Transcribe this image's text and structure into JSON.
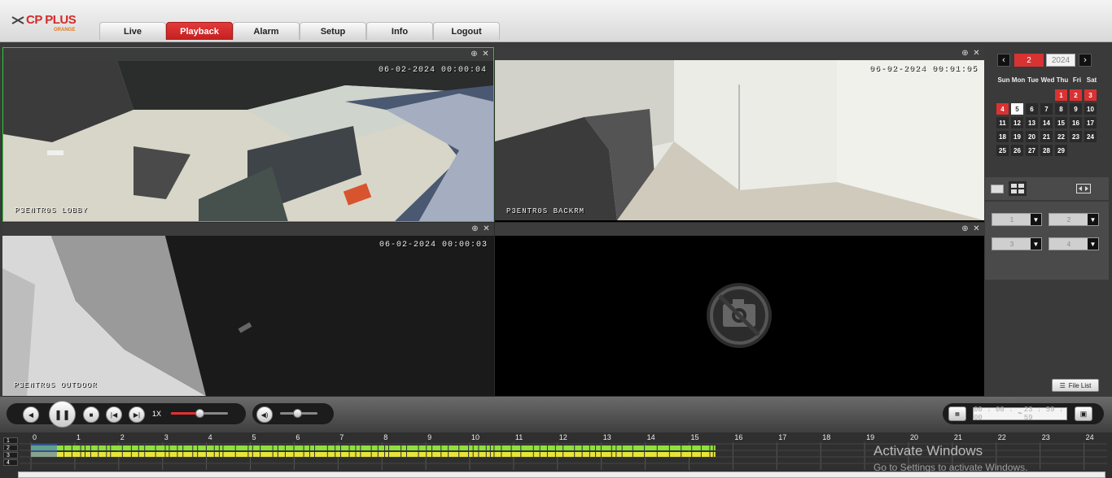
{
  "header": {
    "logo_text": "CP PLUS",
    "logo_sub": "ORANGE",
    "tabs": [
      {
        "label": "Live",
        "active": false
      },
      {
        "label": "Playback",
        "active": true
      },
      {
        "label": "Alarm",
        "active": false
      },
      {
        "label": "Setup",
        "active": false
      },
      {
        "label": "Info",
        "active": false
      },
      {
        "label": "Logout",
        "active": false
      }
    ]
  },
  "panes": [
    {
      "timestamp": "06-02-2024 00:00:04",
      "camera": "P3ENTR0S LOBBY",
      "selected": true
    },
    {
      "timestamp": "06-02-2024 00:01:05",
      "camera": "P3ENTR0S BACKRM",
      "selected": false
    },
    {
      "timestamp": "06-02-2024 00:00:03",
      "camera": "P3ENTR0S OUTDOOR",
      "selected": false
    },
    {
      "timestamp": "",
      "camera": "",
      "selected": false,
      "no_video": true
    }
  ],
  "calendar": {
    "month": "2",
    "year": "2024",
    "prev_icon": "chevron-left-icon",
    "next_icon": "chevron-right-icon",
    "weekdays": [
      "Sun",
      "Mon",
      "Tue",
      "Wed",
      "Thu",
      "Fri",
      "Sat"
    ],
    "first_weekday": 4,
    "days_in_month": 29,
    "record_days": [
      1,
      2,
      3,
      4
    ],
    "selected_day": 5
  },
  "channels": [
    "1",
    "2",
    "3",
    "4"
  ],
  "file_list_label": "File List",
  "controls": {
    "speed": "1X",
    "speed_level": 0.5,
    "volume_level": 0.45,
    "time_start": "00 : 00 : 00",
    "time_end": "23 : 59 : 59",
    "time_separator": "~"
  },
  "timeline": {
    "hours": [
      "0",
      "1",
      "2",
      "3",
      "4",
      "5",
      "6",
      "7",
      "8",
      "9",
      "10",
      "11",
      "12",
      "13",
      "14",
      "15",
      "16",
      "17",
      "18",
      "19",
      "20",
      "21",
      "22",
      "23",
      "24"
    ],
    "row_labels": [
      "1",
      "2",
      "3",
      "4"
    ],
    "recorded_until_hour": 15.6,
    "colors": {
      "continuous": "#8ee03a",
      "motion": "#e8e43a",
      "event": "#3b6bd6"
    }
  },
  "watermark": {
    "line1": "Activate Windows",
    "line2": "Go to Settings to activate Windows."
  }
}
